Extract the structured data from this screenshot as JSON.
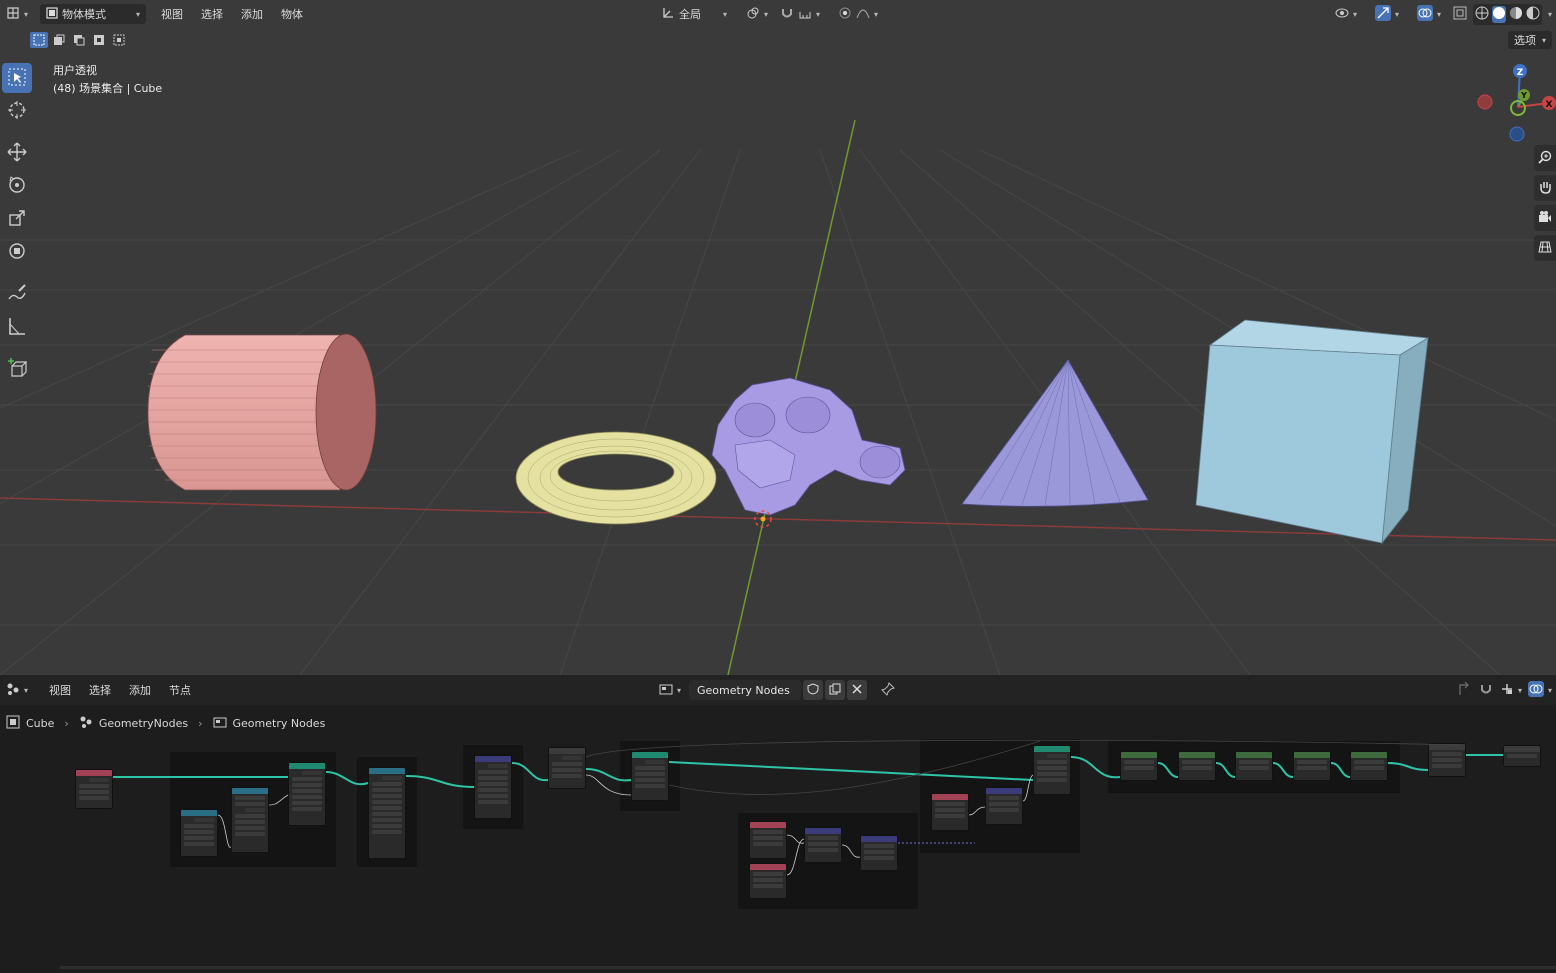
{
  "viewport": {
    "header": {
      "editor_icon": "editor-type-icon",
      "mode_label": "物体模式",
      "menus": [
        "视图",
        "选择",
        "添加",
        "物体"
      ],
      "orientation_label": "全局",
      "options_label": "选项"
    },
    "info": {
      "view_name": "用户透视",
      "collection": "(48) 场景集合 | Cube"
    },
    "tools": [
      "select-box-icon",
      "cursor-icon",
      "move-icon",
      "rotate-icon",
      "scale-icon",
      "transform-icon",
      "annotate-icon",
      "measure-icon",
      "add-cube-icon"
    ],
    "gizmo": {
      "z_label": "Z",
      "y_label": "Y",
      "x_label": "X"
    },
    "objects": [
      "Cylinder",
      "Torus",
      "Suzanne",
      "Cone",
      "Cube"
    ],
    "colors": {
      "cylinder": "#e6a3a0",
      "torus": "#e6e4a3",
      "suzanne": "#a99be3",
      "cone": "#9898d8",
      "cube": "#9ec9dc",
      "x_axis": "#8a3b3b",
      "y_axis": "#6f9a2f"
    }
  },
  "node_editor": {
    "header": {
      "menus": [
        "视图",
        "选择",
        "添加",
        "节点"
      ],
      "tree_name": "Geometry Nodes"
    },
    "breadcrumb": [
      "Cube",
      "GeometryNodes",
      "Geometry Nodes"
    ],
    "link_color": "#2ec4a6"
  }
}
